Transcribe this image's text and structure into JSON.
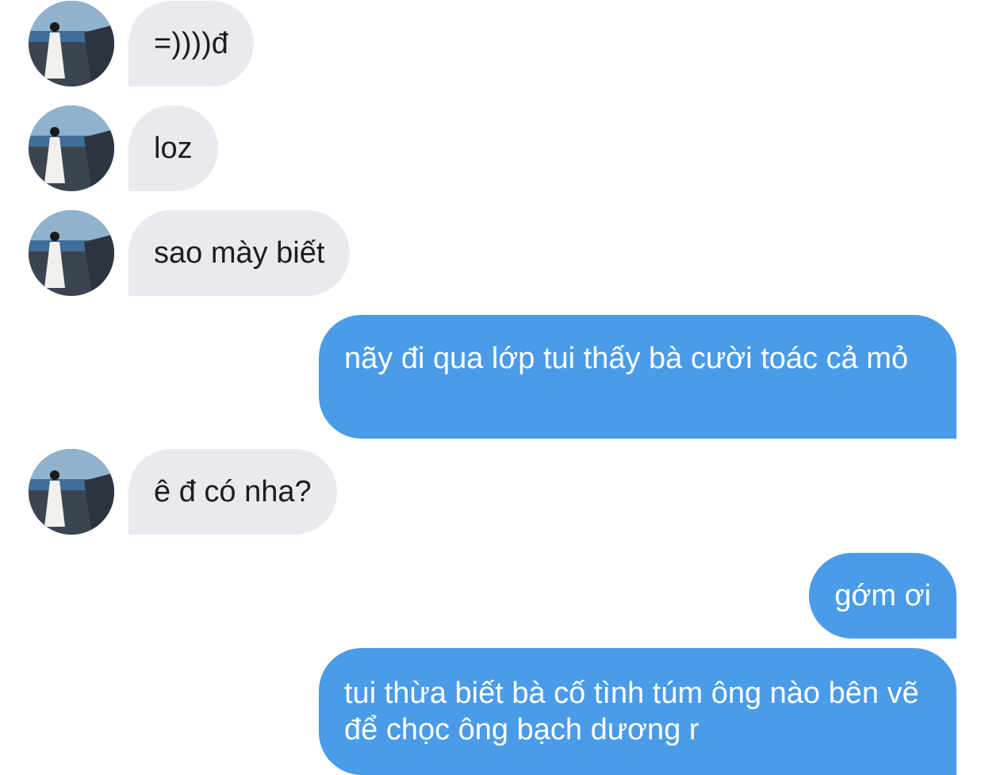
{
  "conversation": {
    "messages": [
      {
        "direction": "incoming",
        "text": "=))))đ"
      },
      {
        "direction": "incoming",
        "text": "loz"
      },
      {
        "direction": "incoming",
        "text": "sao mày biết"
      },
      {
        "direction": "outgoing",
        "text": "nãy đi qua lớp tui thấy bà cười toác cả mỏ"
      },
      {
        "direction": "incoming",
        "text": "ê đ có nha?"
      },
      {
        "direction": "outgoing",
        "text": "gớm ơi"
      },
      {
        "direction": "outgoing",
        "text": "tui thừa biết bà cố tình túm ông nào bên vẽ để chọc ông bạch dương r"
      }
    ]
  },
  "colors": {
    "incoming_bubble": "#e9eaee",
    "outgoing_bubble": "#4a9ce8",
    "incoming_text": "#1c1c1e",
    "outgoing_text": "#ffffff"
  }
}
